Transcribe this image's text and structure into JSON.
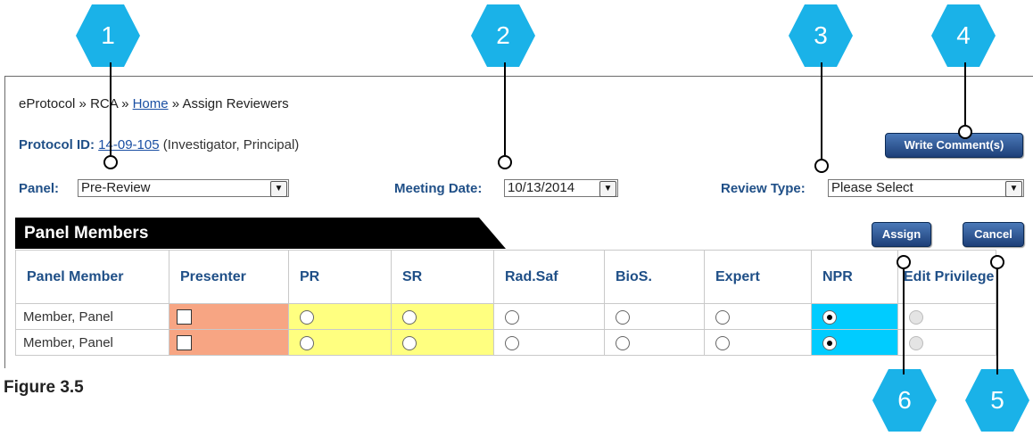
{
  "breadcrumb": {
    "part1": "eProtocol",
    "sep1": "»",
    "part2": "RCA",
    "sep2": "»",
    "home": "Home",
    "sep3": "»",
    "current": "Assign Reviewers"
  },
  "protocol": {
    "label": "Protocol ID:",
    "id": "14-09-105",
    "role": "(Investigator, Principal)"
  },
  "panel": {
    "label": "Panel:",
    "value": "Pre-Review"
  },
  "meeting": {
    "label": "Meeting Date:",
    "value": "10/13/2014"
  },
  "review_type": {
    "label": "Review Type:",
    "value": "Please Select"
  },
  "buttons": {
    "write_comment": "Write Comment(s)",
    "assign": "Assign",
    "cancel": "Cancel"
  },
  "section_title": "Panel Members",
  "table": {
    "headers": [
      "Panel Member",
      "Presenter",
      "PR",
      "SR",
      "Rad.Saf",
      "BioS.",
      "Expert",
      "NPR",
      "Edit Privilege"
    ],
    "rows": [
      {
        "name": "Member, Panel",
        "presenter": false,
        "selected": "NPR"
      },
      {
        "name": "Member, Panel",
        "presenter": false,
        "selected": "NPR"
      }
    ]
  },
  "callouts": [
    "1",
    "2",
    "3",
    "4",
    "5",
    "6"
  ],
  "figure_caption": "Figure 3.5",
  "colors": {
    "callout": "#1ab2e8",
    "label_blue": "#1f4f87",
    "presenter_col": "#f7a583",
    "pr_sr_col": "#ffff80",
    "npr_col": "#00ccff"
  }
}
